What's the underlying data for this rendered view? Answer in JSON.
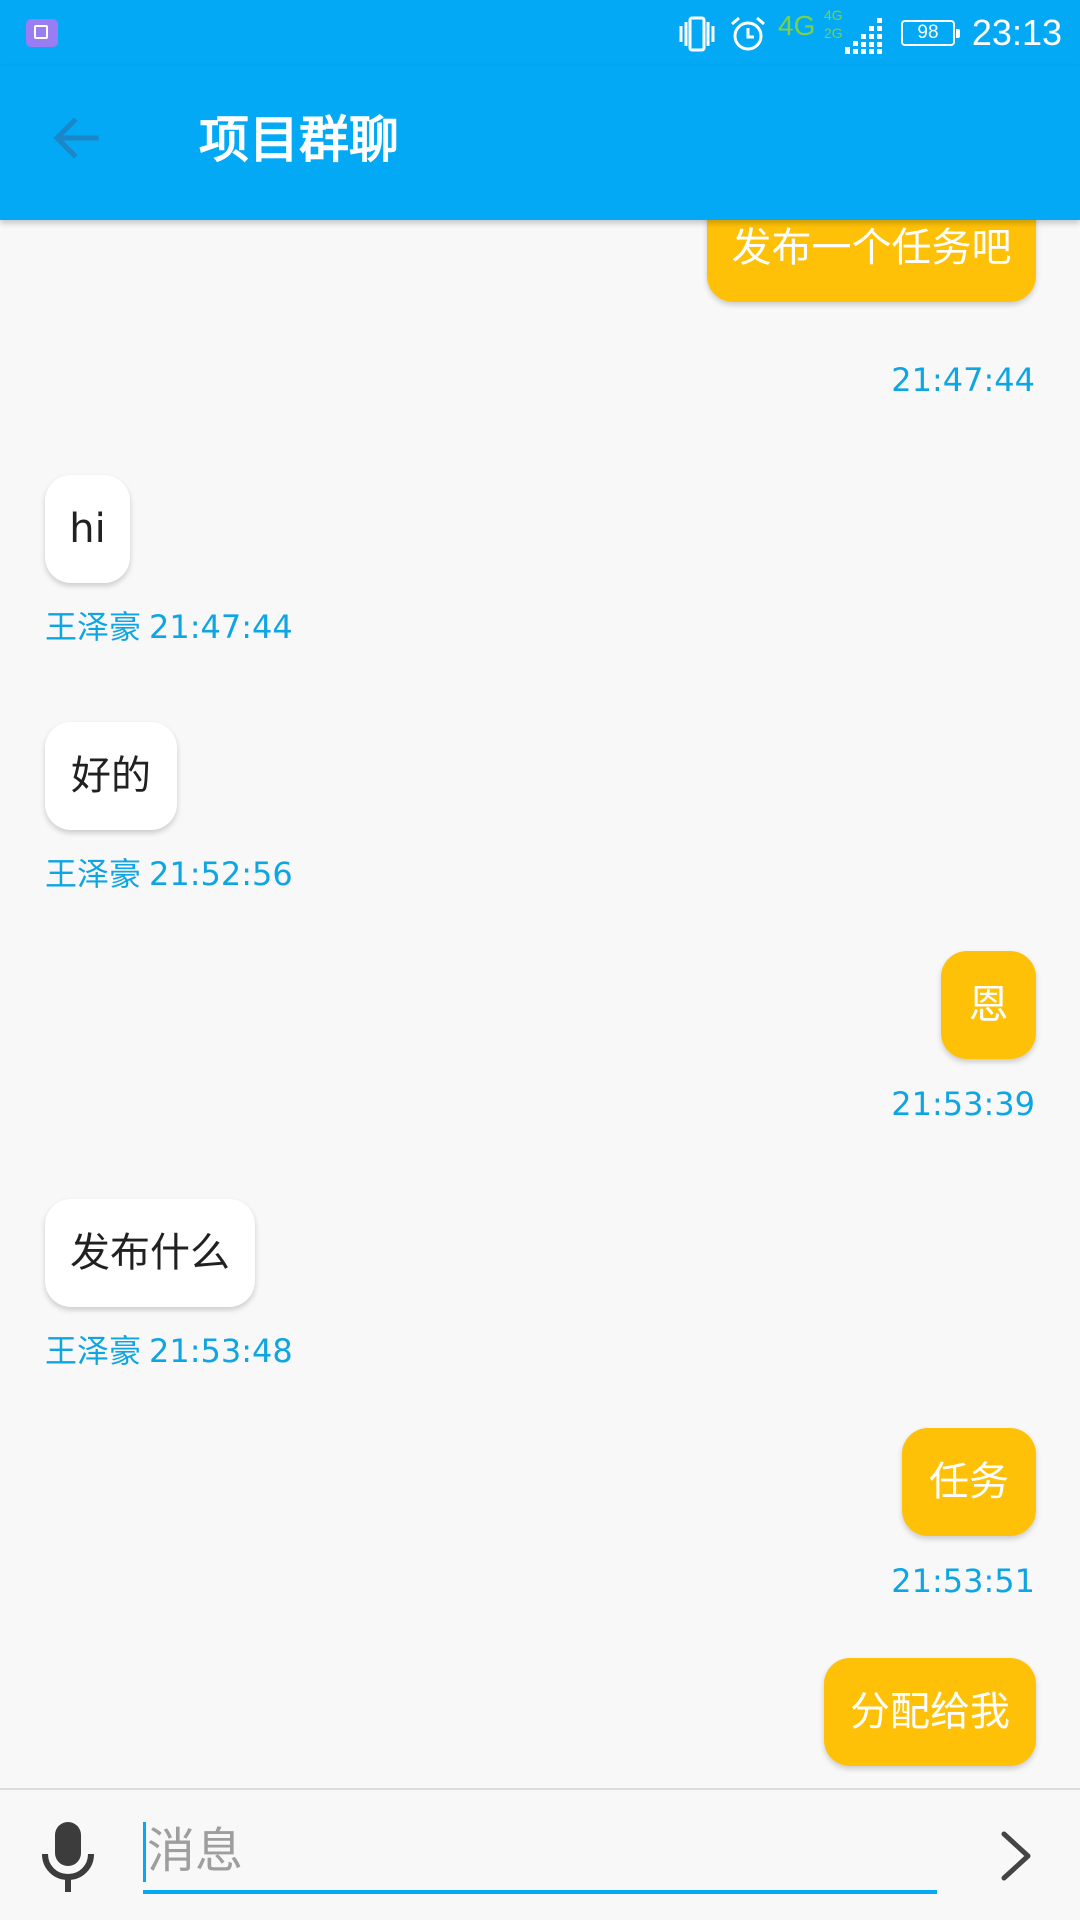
{
  "status_bar": {
    "network": "4G",
    "network_secondary": "4G\n2G",
    "battery": "98",
    "time": "23:13",
    "icons": [
      "gallery-notification-icon",
      "vibrate-icon",
      "alarm-icon",
      "signal-icon",
      "battery-icon"
    ]
  },
  "header": {
    "title": "项目群聊",
    "back_icon": "arrow-left-icon",
    "color": "#03a9f4"
  },
  "colors": {
    "accent": "#03a9f4",
    "my_bubble": "#ffc107",
    "other_bubble": "#ffffff",
    "meta_text": "#0ea5e3"
  },
  "messages": [
    {
      "mine": true,
      "text": "发布一个任务吧",
      "sender": "",
      "time": "21:47:44"
    },
    {
      "mine": false,
      "text": "hi",
      "sender": "王泽豪",
      "time": "21:47:44"
    },
    {
      "mine": false,
      "text": "好的",
      "sender": "王泽豪",
      "time": "21:52:56"
    },
    {
      "mine": true,
      "text": "恩",
      "sender": "",
      "time": "21:53:39"
    },
    {
      "mine": false,
      "text": "发布什么",
      "sender": "王泽豪",
      "time": "21:53:48"
    },
    {
      "mine": true,
      "text": "任务",
      "sender": "",
      "time": "21:53:51"
    },
    {
      "mine": true,
      "text": "分配给我",
      "sender": "",
      "time": ""
    }
  ],
  "composer": {
    "placeholder": "消息",
    "value": "",
    "mic_icon": "microphone-icon",
    "send_icon": "chevron-right-icon"
  }
}
